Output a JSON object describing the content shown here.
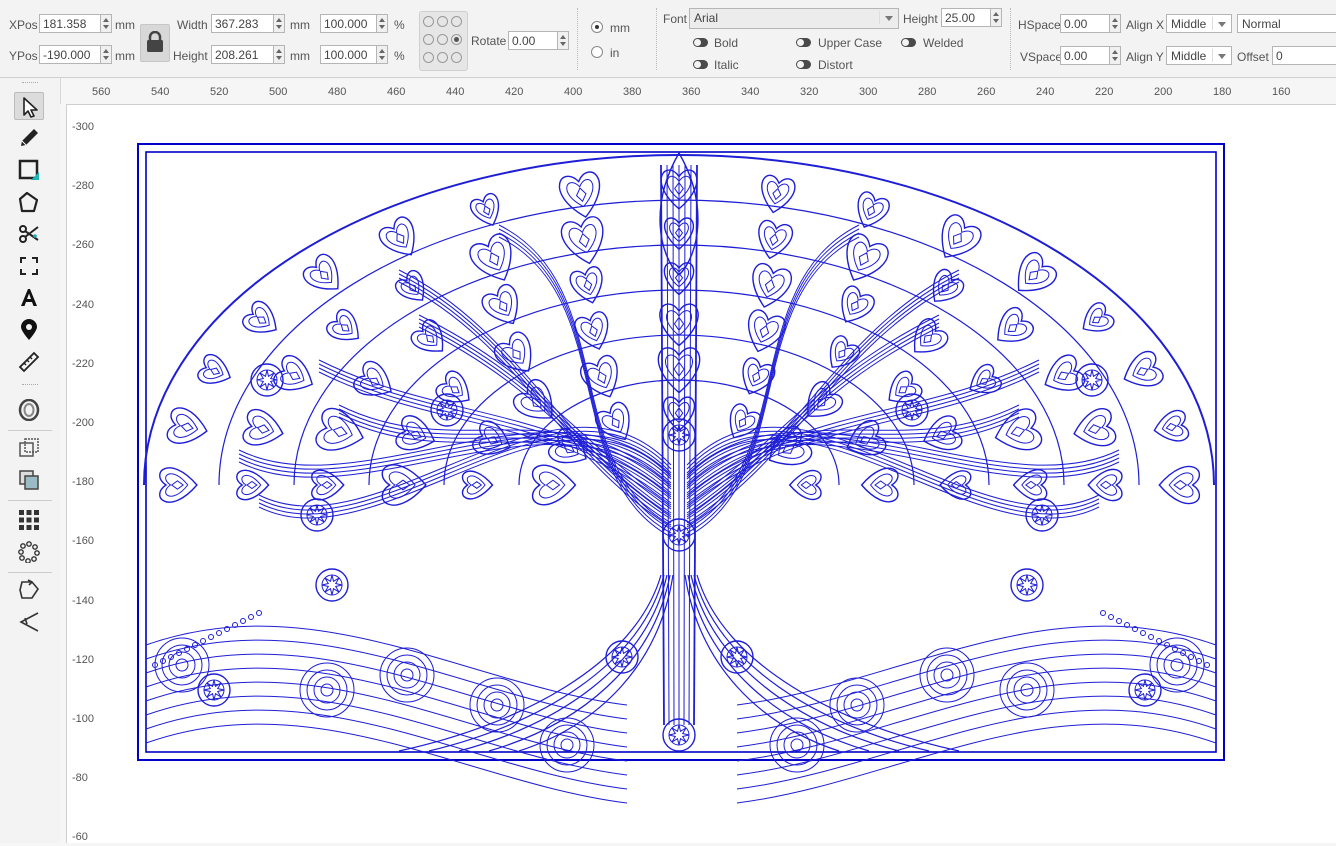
{
  "toolbar": {
    "xpos": {
      "label": "XPos",
      "value": "181.358",
      "unit": "mm"
    },
    "ypos": {
      "label": "YPos",
      "value": "-190.000",
      "unit": "mm"
    },
    "width": {
      "label": "Width",
      "value": "367.283",
      "unit": "mm",
      "pct": "100.000",
      "pct_unit": "%"
    },
    "height": {
      "label": "Height",
      "value": "208.261",
      "unit": "mm",
      "pct": "100.000",
      "pct_unit": "%"
    },
    "rotate": {
      "label": "Rotate",
      "value": "0.00"
    },
    "units": {
      "mm": "mm",
      "in": "in",
      "selected": "mm"
    },
    "font": {
      "label": "Font",
      "value": "Arial"
    },
    "font_height": {
      "label": "Height",
      "value": "25.00"
    },
    "toggles": {
      "bold": "Bold",
      "italic": "Italic",
      "upper_case": "Upper Case",
      "distort": "Distort",
      "welded": "Welded"
    },
    "hspace": {
      "label": "HSpace",
      "value": "0.00"
    },
    "vspace": {
      "label": "VSpace",
      "value": "0.00"
    },
    "align_x": {
      "label": "Align X",
      "value": "Middle"
    },
    "align_y": {
      "label": "Align Y",
      "value": "Middle"
    },
    "mode": {
      "value": "Normal"
    },
    "offset": {
      "label": "Offset",
      "value": "0"
    }
  },
  "tools": [
    {
      "name": "select-tool",
      "icon": "cursor-arrow-icon"
    },
    {
      "name": "draw-lines-tool",
      "icon": "pencil-icon"
    },
    {
      "name": "rectangle-tool",
      "icon": "rectangle-icon"
    },
    {
      "name": "polygon-tool",
      "icon": "pentagon-icon"
    },
    {
      "name": "edit-nodes-tool",
      "icon": "scissors-icon"
    },
    {
      "name": "trim-tool",
      "icon": "trim-corners-icon"
    },
    {
      "name": "text-tool",
      "icon": "text-a-icon"
    },
    {
      "name": "position-laser-tool",
      "icon": "location-pin-icon"
    },
    {
      "name": "measure-tool",
      "icon": "ruler-icon"
    },
    {
      "name": "offset-tool",
      "icon": "offset-shapes-icon"
    },
    {
      "name": "weld-tool",
      "icon": "weld-squares-icon"
    },
    {
      "name": "boolean-tool",
      "icon": "boolean-squares-icon"
    },
    {
      "name": "grid-array-tool",
      "icon": "grid-array-icon"
    },
    {
      "name": "circular-array-tool",
      "icon": "circular-array-icon"
    },
    {
      "name": "path-tool",
      "icon": "path-direction-icon"
    },
    {
      "name": "tab-tool",
      "icon": "tabs-icon"
    }
  ],
  "ruler_top": [
    "560",
    "540",
    "520",
    "500",
    "480",
    "460",
    "440",
    "420",
    "400",
    "380",
    "360",
    "340",
    "320",
    "300",
    "280",
    "260",
    "240",
    "220",
    "200",
    "180",
    "160"
  ],
  "ruler_left": [
    "-300",
    "-280",
    "-260",
    "-240",
    "-220",
    "-200",
    "-180",
    "-160",
    "-140",
    "-120",
    "-100",
    "-80",
    "-60"
  ],
  "colors": {
    "artwork": "#1e1ed6",
    "frame": "#0000c8"
  }
}
